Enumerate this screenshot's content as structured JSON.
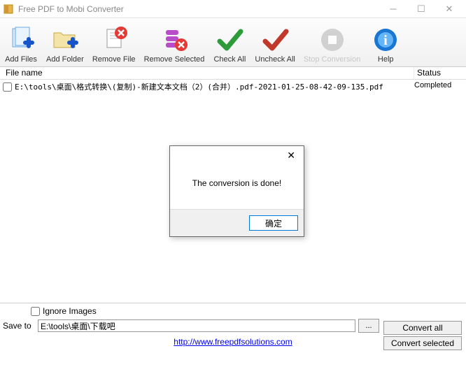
{
  "window": {
    "title": "Free PDF to Mobi Converter"
  },
  "toolbar": {
    "add_files": "Add Files",
    "add_folder": "Add Folder",
    "remove_file": "Remove File",
    "remove_selected": "Remove Selected",
    "check_all": "Check All",
    "uncheck_all": "Uncheck All",
    "stop_conversion": "Stop Conversion",
    "help": "Help"
  },
  "columns": {
    "filename": "File name",
    "status": "Status"
  },
  "files": [
    {
      "name": "E:\\tools\\桌面\\格式转换\\(复制)-新建文本文档（2）(合并）.pdf-2021-01-25-08-42-09-135.pdf",
      "status": "Completed"
    }
  ],
  "options": {
    "ignore_images": "Ignore Images",
    "save_to_label": "Save to",
    "save_to_path": "E:\\tools\\桌面\\下载吧",
    "browse": "...",
    "convert_all": "Convert all",
    "convert_selected": "Convert selected"
  },
  "dialog": {
    "message": "The conversion is done!",
    "ok": "确定"
  },
  "footer": {
    "url": "http://www.freepdfsolutions.com"
  }
}
